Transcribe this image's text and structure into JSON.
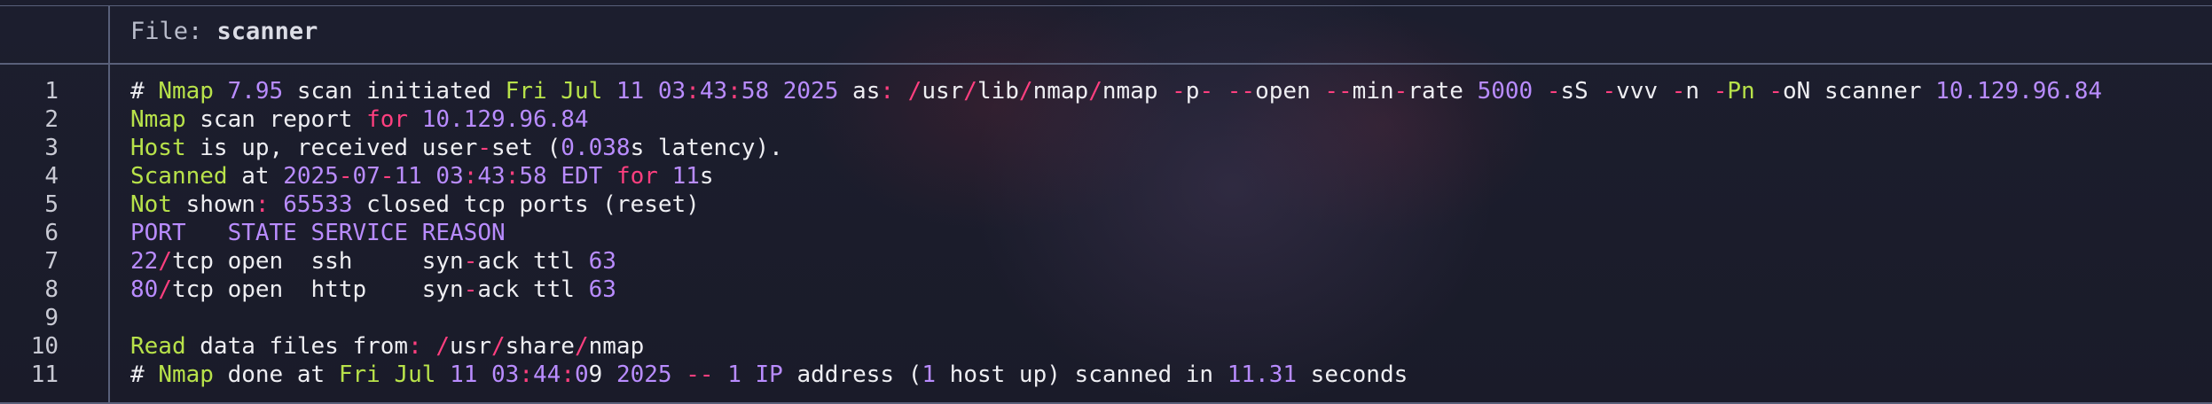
{
  "colors": {
    "background": "#1a1b2a",
    "border": "#59607a",
    "green": "#b8e24a",
    "purple": "#b98cff",
    "pink": "#ff3f7f",
    "text": "#eeeef2"
  },
  "header": {
    "file_label": "File:",
    "file_name": "scanner"
  },
  "lines": [
    {
      "number": "1",
      "tokens": [
        {
          "t": "# ",
          "c": "w"
        },
        {
          "t": "Nmap",
          "c": "g"
        },
        {
          "t": " ",
          "c": "w"
        },
        {
          "t": "7.95",
          "c": "p"
        },
        {
          "t": " scan initiated ",
          "c": "w"
        },
        {
          "t": "Fri Jul",
          "c": "g"
        },
        {
          "t": " ",
          "c": "w"
        },
        {
          "t": "11 03",
          "c": "p"
        },
        {
          "t": ":",
          "c": "r"
        },
        {
          "t": "43",
          "c": "p"
        },
        {
          "t": ":",
          "c": "r"
        },
        {
          "t": "58 2025",
          "c": "p"
        },
        {
          "t": " as",
          "c": "w"
        },
        {
          "t": ":",
          "c": "r"
        },
        {
          "t": " ",
          "c": "w"
        },
        {
          "t": "/",
          "c": "r"
        },
        {
          "t": "usr",
          "c": "w"
        },
        {
          "t": "/",
          "c": "r"
        },
        {
          "t": "lib",
          "c": "w"
        },
        {
          "t": "/",
          "c": "r"
        },
        {
          "t": "nmap",
          "c": "w"
        },
        {
          "t": "/",
          "c": "r"
        },
        {
          "t": "nmap ",
          "c": "w"
        },
        {
          "t": "-",
          "c": "r"
        },
        {
          "t": "p",
          "c": "w"
        },
        {
          "t": "-",
          "c": "r"
        },
        {
          "t": " ",
          "c": "w"
        },
        {
          "t": "--",
          "c": "r"
        },
        {
          "t": "open ",
          "c": "w"
        },
        {
          "t": "--",
          "c": "r"
        },
        {
          "t": "min",
          "c": "w"
        },
        {
          "t": "-",
          "c": "r"
        },
        {
          "t": "rate ",
          "c": "w"
        },
        {
          "t": "5000",
          "c": "p"
        },
        {
          "t": " ",
          "c": "w"
        },
        {
          "t": "-",
          "c": "r"
        },
        {
          "t": "sS ",
          "c": "w"
        },
        {
          "t": "-",
          "c": "r"
        },
        {
          "t": "vvv ",
          "c": "w"
        },
        {
          "t": "-",
          "c": "r"
        },
        {
          "t": "n ",
          "c": "w"
        },
        {
          "t": "-",
          "c": "r"
        },
        {
          "t": "Pn",
          "c": "g"
        },
        {
          "t": " ",
          "c": "w"
        },
        {
          "t": "-",
          "c": "r"
        },
        {
          "t": "oN scanner ",
          "c": "w"
        },
        {
          "t": "10.129.96.84",
          "c": "p"
        }
      ]
    },
    {
      "number": "2",
      "tokens": [
        {
          "t": "Nmap",
          "c": "g"
        },
        {
          "t": " scan report ",
          "c": "w"
        },
        {
          "t": "for",
          "c": "r"
        },
        {
          "t": " ",
          "c": "w"
        },
        {
          "t": "10.129.96.84",
          "c": "p"
        }
      ]
    },
    {
      "number": "3",
      "tokens": [
        {
          "t": "Host",
          "c": "g"
        },
        {
          "t": " is up, received user",
          "c": "w"
        },
        {
          "t": "-",
          "c": "r"
        },
        {
          "t": "set (",
          "c": "w"
        },
        {
          "t": "0.038",
          "c": "p"
        },
        {
          "t": "s latency).",
          "c": "w"
        }
      ]
    },
    {
      "number": "4",
      "tokens": [
        {
          "t": "Scanned",
          "c": "g"
        },
        {
          "t": " at ",
          "c": "w"
        },
        {
          "t": "2025",
          "c": "p"
        },
        {
          "t": "-",
          "c": "r"
        },
        {
          "t": "07",
          "c": "p"
        },
        {
          "t": "-",
          "c": "r"
        },
        {
          "t": "11 03",
          "c": "p"
        },
        {
          "t": ":",
          "c": "r"
        },
        {
          "t": "43",
          "c": "p"
        },
        {
          "t": ":",
          "c": "r"
        },
        {
          "t": "58",
          "c": "p"
        },
        {
          "t": " ",
          "c": "w"
        },
        {
          "t": "EDT",
          "c": "p"
        },
        {
          "t": " ",
          "c": "w"
        },
        {
          "t": "for",
          "c": "r"
        },
        {
          "t": " ",
          "c": "w"
        },
        {
          "t": "11",
          "c": "p"
        },
        {
          "t": "s",
          "c": "w"
        }
      ]
    },
    {
      "number": "5",
      "tokens": [
        {
          "t": "Not",
          "c": "g"
        },
        {
          "t": " shown",
          "c": "w"
        },
        {
          "t": ":",
          "c": "r"
        },
        {
          "t": " ",
          "c": "w"
        },
        {
          "t": "65533",
          "c": "p"
        },
        {
          "t": " closed tcp ports (reset)",
          "c": "w"
        }
      ]
    },
    {
      "number": "6",
      "tokens": [
        {
          "t": "PORT   STATE SERVICE REASON",
          "c": "p"
        }
      ]
    },
    {
      "number": "7",
      "tokens": [
        {
          "t": "22",
          "c": "p"
        },
        {
          "t": "/",
          "c": "r"
        },
        {
          "t": "tcp open  ssh     syn",
          "c": "w"
        },
        {
          "t": "-",
          "c": "r"
        },
        {
          "t": "ack ttl ",
          "c": "w"
        },
        {
          "t": "63",
          "c": "p"
        }
      ]
    },
    {
      "number": "8",
      "tokens": [
        {
          "t": "80",
          "c": "p"
        },
        {
          "t": "/",
          "c": "r"
        },
        {
          "t": "tcp open  http    syn",
          "c": "w"
        },
        {
          "t": "-",
          "c": "r"
        },
        {
          "t": "ack ttl ",
          "c": "w"
        },
        {
          "t": "63",
          "c": "p"
        }
      ]
    },
    {
      "number": "9",
      "tokens": []
    },
    {
      "number": "10",
      "tokens": [
        {
          "t": "Read",
          "c": "g"
        },
        {
          "t": " data files from",
          "c": "w"
        },
        {
          "t": ":",
          "c": "r"
        },
        {
          "t": " ",
          "c": "w"
        },
        {
          "t": "/",
          "c": "r"
        },
        {
          "t": "usr",
          "c": "w"
        },
        {
          "t": "/",
          "c": "r"
        },
        {
          "t": "share",
          "c": "w"
        },
        {
          "t": "/",
          "c": "r"
        },
        {
          "t": "nmap",
          "c": "w"
        }
      ]
    },
    {
      "number": "11",
      "tokens": [
        {
          "t": "# ",
          "c": "w"
        },
        {
          "t": "Nmap",
          "c": "g"
        },
        {
          "t": " done at ",
          "c": "w"
        },
        {
          "t": "Fri Jul",
          "c": "g"
        },
        {
          "t": " ",
          "c": "w"
        },
        {
          "t": "11 03",
          "c": "p"
        },
        {
          "t": ":",
          "c": "r"
        },
        {
          "t": "44",
          "c": "p"
        },
        {
          "t": ":",
          "c": "r"
        },
        {
          "t": "0",
          "c": "p"
        },
        {
          "t": "9 ",
          "c": "w"
        },
        {
          "t": "2025",
          "c": "p"
        },
        {
          "t": " ",
          "c": "w"
        },
        {
          "t": "--",
          "c": "r"
        },
        {
          "t": " ",
          "c": "w"
        },
        {
          "t": "1",
          "c": "p"
        },
        {
          "t": " ",
          "c": "w"
        },
        {
          "t": "IP",
          "c": "p"
        },
        {
          "t": " address (",
          "c": "w"
        },
        {
          "t": "1",
          "c": "p"
        },
        {
          "t": " host up) scanned in ",
          "c": "w"
        },
        {
          "t": "11.31",
          "c": "p"
        },
        {
          "t": " seconds",
          "c": "w"
        }
      ]
    }
  ]
}
